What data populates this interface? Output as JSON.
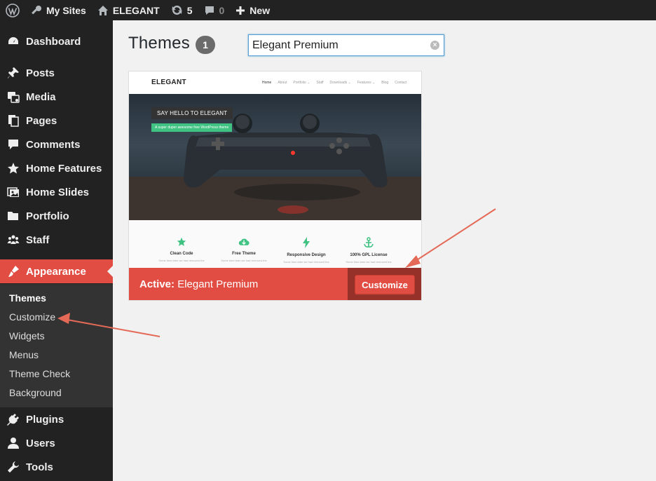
{
  "admin_bar": {
    "my_sites": "My Sites",
    "site_name": "ELEGANT",
    "updates_count": "5",
    "comments_count": "0",
    "new_label": "New"
  },
  "sidebar": {
    "items": [
      {
        "label": "Dashboard",
        "icon": "dashboard-icon"
      },
      {
        "label": "Posts",
        "icon": "pin-icon"
      },
      {
        "label": "Media",
        "icon": "media-icon"
      },
      {
        "label": "Pages",
        "icon": "pages-icon"
      },
      {
        "label": "Comments",
        "icon": "comment-icon"
      },
      {
        "label": "Home Features",
        "icon": "star-icon"
      },
      {
        "label": "Home Slides",
        "icon": "slides-icon"
      },
      {
        "label": "Portfolio",
        "icon": "folder-icon"
      },
      {
        "label": "Staff",
        "icon": "staff-icon"
      },
      {
        "label": "Appearance",
        "icon": "brush-icon",
        "active": true
      },
      {
        "label": "Plugins",
        "icon": "plug-icon"
      },
      {
        "label": "Users",
        "icon": "user-icon"
      },
      {
        "label": "Tools",
        "icon": "wrench-icon"
      }
    ],
    "submenu": [
      "Themes",
      "Customize",
      "Widgets",
      "Menus",
      "Theme Check",
      "Background"
    ],
    "submenu_current": "Themes"
  },
  "main": {
    "title": "Themes",
    "count": "1",
    "search_value": "Elegant Premium"
  },
  "theme": {
    "preview": {
      "logo": "ELEGANT",
      "nav": [
        "Home",
        "About",
        "Portfolio ⌄",
        "Staff",
        "Downloads ⌄",
        "Features ⌄",
        "Blog",
        "Contact"
      ],
      "hero_title": "SAY HELLO TO ELEGANT",
      "hero_subtitle": "A super duper awesome free WordPress theme",
      "features": [
        {
          "title": "Clean Code",
          "icon": "star-icon",
          "text": "Some time later we had removed the"
        },
        {
          "title": "Free Theme",
          "icon": "cloud-download-icon",
          "text": "Some time later we had removed the"
        },
        {
          "title": "Responsive Design",
          "icon": "bolt-icon",
          "text": "Some time later we had removed the"
        },
        {
          "title": "100% GPL License",
          "icon": "anchor-icon",
          "text": "Some time later we had removed the"
        }
      ]
    },
    "active_prefix": "Active:",
    "active_name": "Elegant Premium",
    "customize_label": "Customize"
  },
  "colors": {
    "accent": "#e14d43",
    "sidebar_bg": "#222222",
    "submenu_bg": "#333333",
    "feature_green": "#3fc282"
  }
}
